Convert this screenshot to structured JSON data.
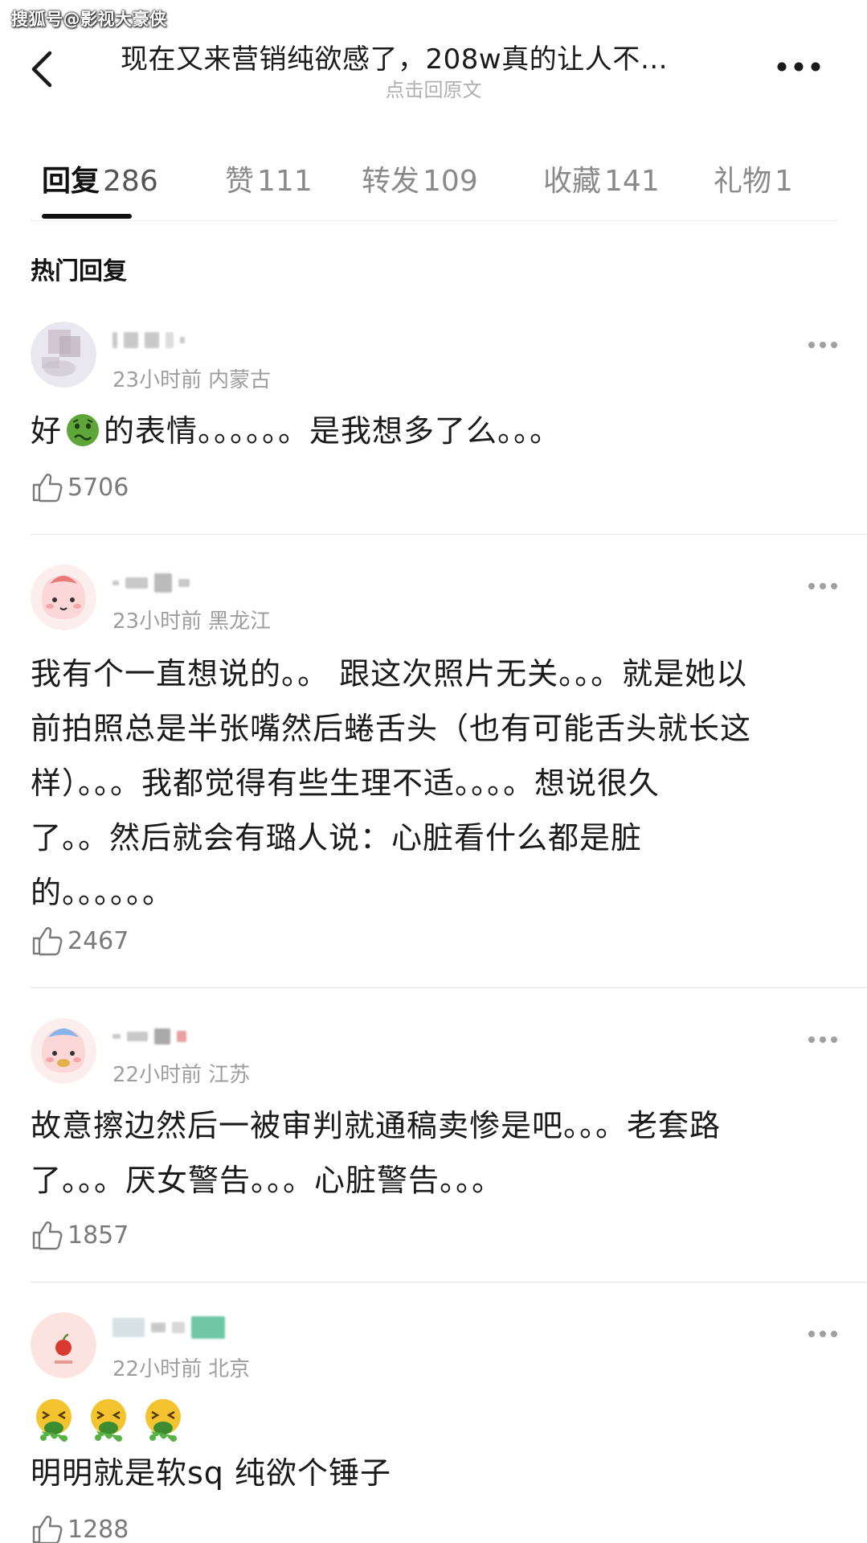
{
  "watermark": "搜狐号@影视大豪侠",
  "header": {
    "title": "现在又来营销纯欲感了，208w真的让人不…",
    "subtitle": "点击回原文"
  },
  "tabs": [
    {
      "label": "回复",
      "count": "286",
      "active": true
    },
    {
      "label": "赞",
      "count": "111",
      "active": false
    },
    {
      "label": "转发",
      "count": "109",
      "active": false
    },
    {
      "label": "收藏",
      "count": "141",
      "active": false
    },
    {
      "label": "礼物",
      "count": "1",
      "active": false
    }
  ],
  "section_title": "热门回复",
  "emoji_icons": [
    "nauseated-face-icon",
    "vomiting-face-icon"
  ],
  "comments": [
    {
      "time": "23小时前",
      "location": "内蒙古",
      "text_before_emoji": "好",
      "text_after_emoji": "的表情。。。。。。是我想多了么。。。",
      "likes": "5706"
    },
    {
      "time": "23小时前",
      "location": "黑龙江",
      "lines": [
        "我有个一直想说的。。 跟这次照片无关。。。就是她以",
        "前拍照总是半张嘴然后蜷舌头（也有可能舌头就长这",
        "样）。。。我都觉得有些生理不适。。。。想说很久",
        "了。。然后就会有璐人说：心脏看什么都是脏",
        "的。。。。。。"
      ],
      "likes": "2467"
    },
    {
      "time": "22小时前",
      "location": "江苏",
      "lines": [
        "故意擦边然后一被审判就通稿卖惨是吧。。。老套路",
        "了。。。厌女警告。。。心脏警告。。。"
      ],
      "likes": "1857"
    },
    {
      "time": "22小时前",
      "location": "北京",
      "text": "明明就是软sq 纯欲个锤子",
      "likes": "1288"
    }
  ]
}
